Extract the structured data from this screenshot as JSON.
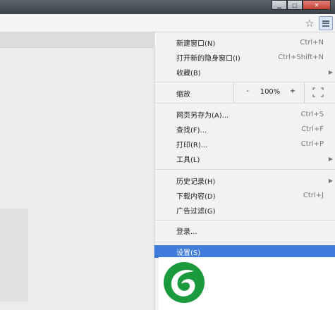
{
  "window": {
    "controls": [
      "minimize",
      "maximize",
      "close"
    ]
  },
  "toolbar": {
    "bookmark_icon": "star-icon",
    "menu_icon": "hamburger-icon"
  },
  "menu": {
    "group1": [
      {
        "label": "新建窗口(N)",
        "shortcut": "Ctrl+N"
      },
      {
        "label": "打开新的隐身窗口(I)",
        "shortcut": "Ctrl+Shift+N"
      },
      {
        "label": "收藏(B)",
        "submenu": true
      }
    ],
    "zoom": {
      "label": "缩放",
      "minus": "-",
      "value": "100%",
      "plus": "+"
    },
    "group2": [
      {
        "label": "网页另存为(A)...",
        "shortcut": "Ctrl+S"
      },
      {
        "label": "查找(F)...",
        "shortcut": "Ctrl+F"
      },
      {
        "label": "打印(R)...",
        "shortcut": "Ctrl+P"
      },
      {
        "label": "工具(L)",
        "submenu": true
      }
    ],
    "group3": [
      {
        "label": "历史记录(H)",
        "submenu": true
      },
      {
        "label": "下载内容(D)",
        "shortcut": "Ctrl+J"
      },
      {
        "label": "广告过滤(G)"
      }
    ],
    "login": {
      "label": "登录..."
    },
    "settings": {
      "label": "设置(S)",
      "highlight_color": "#3f7bd9"
    }
  },
  "colors": {
    "logo_green": "#1a9a3c"
  }
}
